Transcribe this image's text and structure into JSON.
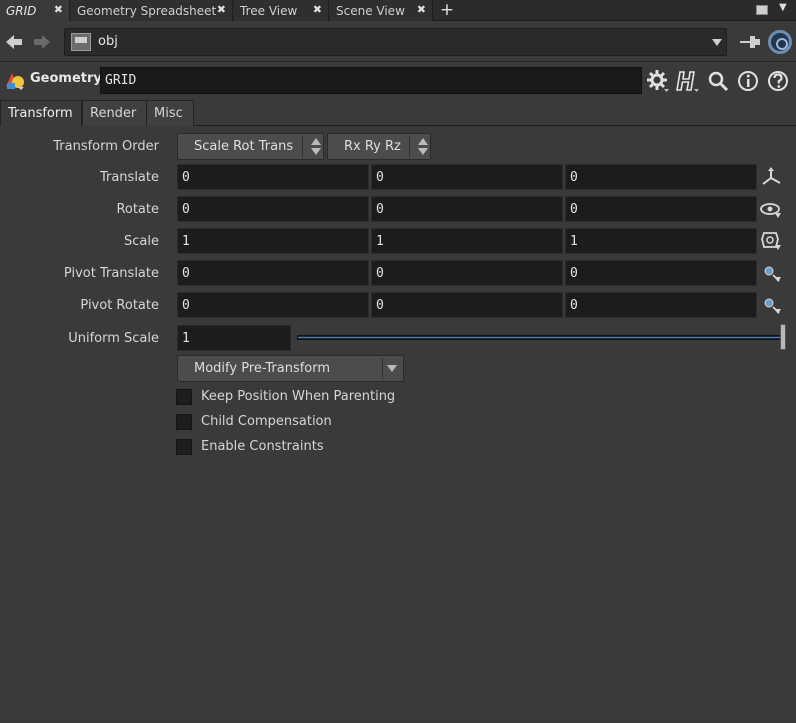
{
  "tabs": [
    {
      "label": "GRID",
      "active": true
    },
    {
      "label": "Geometry Spreadsheet",
      "active": false
    },
    {
      "label": "Tree View",
      "active": false
    },
    {
      "label": "Scene View",
      "active": false
    }
  ],
  "tab_close_glyph": "✖",
  "tab_add_glyph": "+",
  "path": {
    "value": "obj"
  },
  "node": {
    "type_label": "Geometry",
    "name": "GRID"
  },
  "subtabs": [
    "Transform",
    "Render",
    "Misc"
  ],
  "params": {
    "transform_order_label": "Transform Order",
    "transform_order_value": "Scale Rot Trans",
    "rotation_order_value": "Rx Ry Rz",
    "rows": [
      {
        "label": "Translate",
        "values": [
          "0",
          "0",
          "0"
        ],
        "icon": "handle-icon"
      },
      {
        "label": "Rotate",
        "values": [
          "0",
          "0",
          "0"
        ],
        "icon": "eye-rotate-icon"
      },
      {
        "label": "Scale",
        "values": [
          "1",
          "1",
          "1"
        ],
        "icon": "scale-icon"
      },
      {
        "label": "Pivot Translate",
        "values": [
          "0",
          "0",
          "0"
        ],
        "icon": "pivot-translate-icon"
      },
      {
        "label": "Pivot Rotate",
        "values": [
          "0",
          "0",
          "0"
        ],
        "icon": "pivot-rotate-icon"
      }
    ],
    "uniform_scale_label": "Uniform Scale",
    "uniform_scale_value": "1",
    "uniform_scale_slider": 1.0,
    "modify_menu_value": "Modify Pre-Transform",
    "checkboxes": [
      {
        "label": "Keep Position When Parenting",
        "checked": false
      },
      {
        "label": "Child Compensation",
        "checked": false
      },
      {
        "label": "Enable Constraints",
        "checked": false
      }
    ]
  },
  "colors": {
    "accent": "#4a7db6",
    "background": "#3a3a3a",
    "field": "#1c1c1c"
  }
}
